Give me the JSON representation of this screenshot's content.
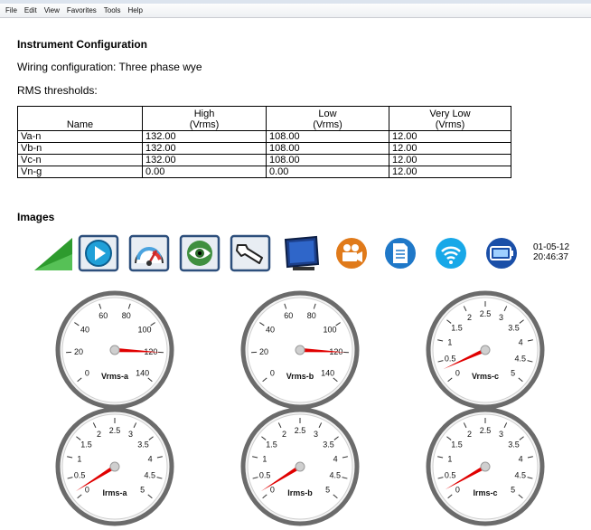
{
  "menu": [
    "File",
    "Edit",
    "View",
    "Favorites",
    "Tools",
    "Help"
  ],
  "config": {
    "title": "Instrument Configuration",
    "wiring_label": "Wiring configuration: Three phase wye",
    "rms_label": "RMS thresholds:"
  },
  "table": {
    "headers": [
      {
        "line1": "",
        "line2": "Name"
      },
      {
        "line1": "High",
        "line2": "(Vrms)"
      },
      {
        "line1": "Low",
        "line2": "(Vrms)"
      },
      {
        "line1": "Very Low",
        "line2": "(Vrms)"
      }
    ],
    "rows": [
      [
        "Va-n",
        "132.00",
        "108.00",
        "12.00"
      ],
      [
        "Vb-n",
        "132.00",
        "108.00",
        "12.00"
      ],
      [
        "Vc-n",
        "132.00",
        "108.00",
        "12.00"
      ],
      [
        "Vn-g",
        "0.00",
        "0.00",
        "12.00"
      ]
    ]
  },
  "images_heading": "Images",
  "toolbar": {
    "icons": [
      "signal-strength-icon",
      "play-icon",
      "dial-meter-icon",
      "eye-icon",
      "wrench-icon",
      "monitor-icon",
      "video-camera-icon",
      "document-icon",
      "wireless-icon",
      "battery-icon"
    ],
    "date": "01-05-12",
    "time": "20:46:37"
  },
  "gauges": [
    {
      "label": "Vrms-a",
      "scale": "voltage",
      "ticks": [
        "0",
        "20",
        "40",
        "60",
        "80",
        "100",
        "120",
        "140"
      ],
      "min": 0,
      "max": 140,
      "value": 120
    },
    {
      "label": "Vrms-b",
      "scale": "voltage",
      "ticks": [
        "0",
        "20",
        "40",
        "60",
        "80",
        "100",
        "120",
        "140"
      ],
      "min": 0,
      "max": 140,
      "value": 120
    },
    {
      "label": "Vrms-c",
      "scale": "current",
      "ticks": [
        "0",
        "0.5",
        "1",
        "1.5",
        "2",
        "2.5",
        "3",
        "3.5",
        "4",
        "4.5",
        "5"
      ],
      "min": 0,
      "max": 5,
      "value": 0.3
    },
    {
      "label": "Irms-a",
      "scale": "current",
      "ticks": [
        "0",
        "0.5",
        "1",
        "1.5",
        "2",
        "2.5",
        "3",
        "3.5",
        "4",
        "4.5",
        "5"
      ],
      "min": 0,
      "max": 5,
      "value": 0.15
    },
    {
      "label": "Irms-b",
      "scale": "current",
      "ticks": [
        "0",
        "0.5",
        "1",
        "1.5",
        "2",
        "2.5",
        "3",
        "3.5",
        "4",
        "4.5",
        "5"
      ],
      "min": 0,
      "max": 5,
      "value": 0.15
    },
    {
      "label": "Irms-c",
      "scale": "current",
      "ticks": [
        "0",
        "0.5",
        "1",
        "1.5",
        "2",
        "2.5",
        "3",
        "3.5",
        "4",
        "4.5",
        "5"
      ],
      "min": 0,
      "max": 5,
      "value": 0.2
    }
  ],
  "colors": {
    "needle": "#e00000",
    "signal_green": "#2e9b2e",
    "icon_blue": "#1f78c8",
    "icon_orange": "#e07a1a"
  }
}
